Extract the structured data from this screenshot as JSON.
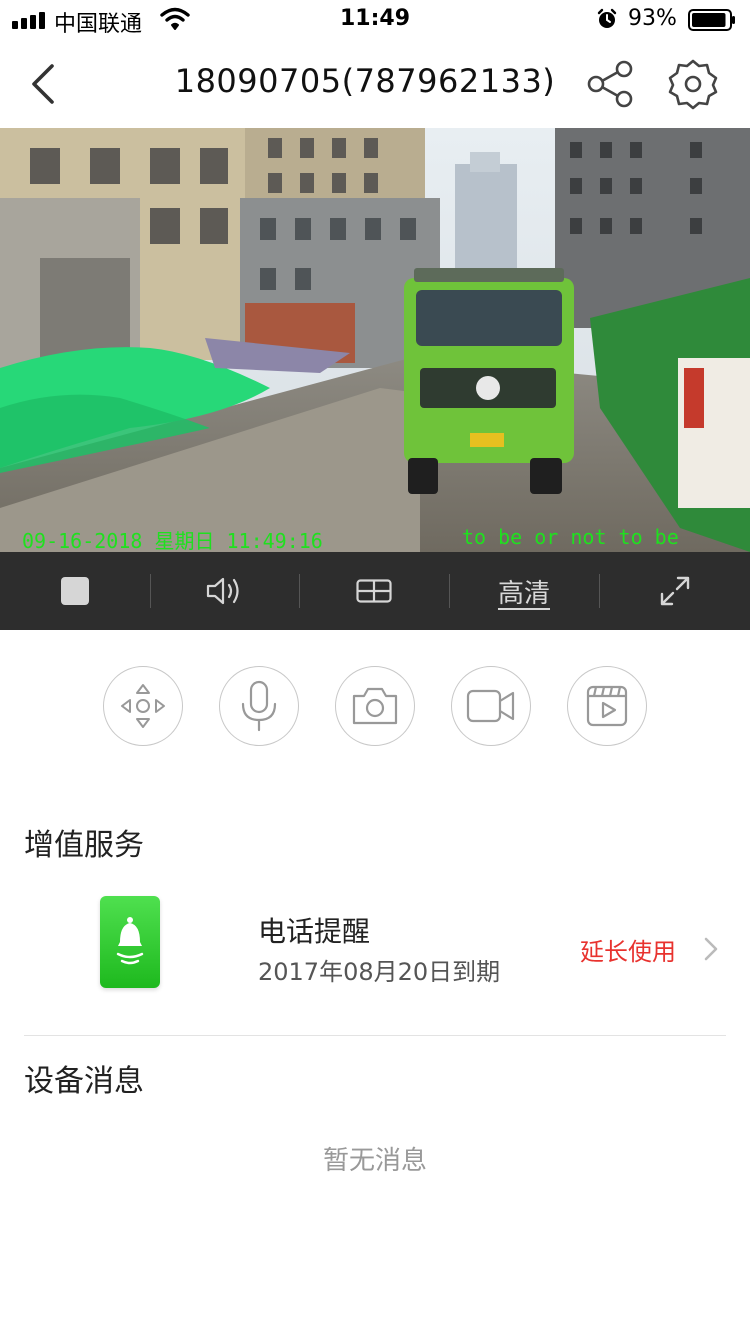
{
  "status_bar": {
    "carrier": "中国联通",
    "time": "11:49",
    "battery_percent": "93%",
    "battery_level": 0.93
  },
  "header": {
    "title": "18090705(787962133)",
    "back_icon": "chevron-left-icon",
    "share_icon": "share-icon",
    "settings_icon": "gear-icon"
  },
  "video": {
    "osd_timestamp": "09-16-2018 星期日 11:49:16",
    "osd_text": "to be or not to be"
  },
  "controls": {
    "stop_icon": "stop-icon",
    "volume_icon": "speaker-icon",
    "layout_icon": "grid-layout-icon",
    "quality_label": "高清",
    "fullscreen_icon": "expand-icon"
  },
  "actions": [
    {
      "icon": "ptz-direction-icon"
    },
    {
      "icon": "microphone-icon"
    },
    {
      "icon": "camera-snapshot-icon"
    },
    {
      "icon": "video-record-icon"
    },
    {
      "icon": "playback-icon"
    }
  ],
  "value_services": {
    "title": "增值服务",
    "item": {
      "name": "电话提醒",
      "expiry": "2017年08月20日到期",
      "action_label": "延长使用",
      "icon": "bell-alert-icon",
      "accent_color": "#e8322e"
    }
  },
  "device_messages": {
    "title": "设备消息",
    "empty_text": "暂无消息"
  }
}
